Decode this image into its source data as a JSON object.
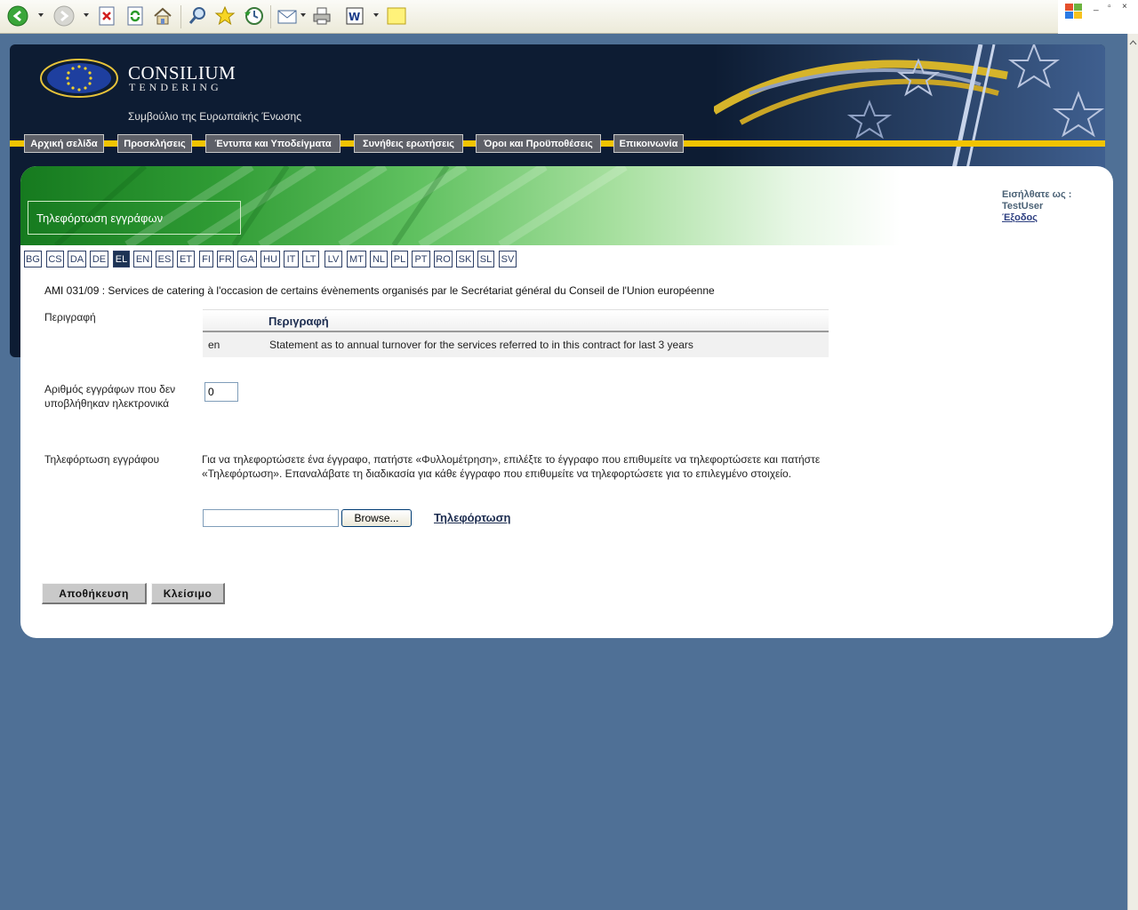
{
  "browser": {
    "toolbar_icons": [
      "back-icon",
      "forward-icon",
      "stop-icon",
      "refresh-icon",
      "home-icon",
      "search-icon",
      "favorites-icon",
      "history-icon",
      "mail-icon",
      "print-icon",
      "edit-icon",
      "note-icon"
    ],
    "window_controls": [
      "_",
      "▫",
      "×"
    ]
  },
  "header": {
    "logo_title": "CONSILIUM",
    "logo_subtitle": "TENDERING",
    "council": "Συμβούλιο της Ευρωπαϊκής Ένωσης",
    "nav": [
      {
        "label": "Αρχική σελίδα"
      },
      {
        "label": "Προσκλήσεις"
      },
      {
        "label": "Έντυπα και Υποδείγματα"
      },
      {
        "label": "Συνήθεις ερωτήσεις"
      },
      {
        "label": "Όροι και Προϋποθέσεις"
      },
      {
        "label": "Επικοινωνία"
      }
    ],
    "colors": {
      "band": "#f2c400",
      "background": "#0d1c33"
    }
  },
  "page": {
    "title": "Τηλεφόρτωση εγγράφων",
    "login_label": "Εισήλθατε ως :",
    "user": "TestUser",
    "logout": "Έξοδος",
    "languages": [
      "BG",
      "CS",
      "DA",
      "DE",
      "EL",
      "EN",
      "ES",
      "ET",
      "FI",
      "FR",
      "GA",
      "HU",
      "IT",
      "LT",
      "LV",
      "MT",
      "NL",
      "PL",
      "PT",
      "RO",
      "SK",
      "SL",
      "SV"
    ],
    "active_language": "EL",
    "ami_title": "AMI 031/09 : Services de catering à l'occasion de certains évènements organisés par le Secrétariat général du Conseil de l'Union européenne"
  },
  "form": {
    "description_label": "Περιγραφή",
    "table": {
      "header": "Περιγραφή",
      "rows": [
        {
          "lang": "en",
          "text": "Statement as to annual turnover for the services referred to in this contract for last 3 years"
        }
      ]
    },
    "count_label": "Αριθμός εγγράφων που δεν υποβλήθηκαν ηλεκτρονικά",
    "count_value": "0",
    "upload_label": "Τηλεφόρτωση εγγράφου",
    "upload_help": "Για να τηλεφορτώσετε ένα έγγραφο, πατήστε «Φυλλομέτρηση», επιλέξτε το έγγραφο που επιθυμείτε να τηλεφορτώσετε και πατήστε «Τηλεφόρτωση». Επαναλάβατε τη διαδικασία για κάθε έγγραφο που επιθυμείτε να τηλεφορτώσετε για το επιλεγμένο στοιχείο.",
    "browse_label": "Browse...",
    "upload_link": "Τηλεφόρτωση",
    "save_label": "Αποθήκευση",
    "close_label": "Κλείσιμο"
  }
}
